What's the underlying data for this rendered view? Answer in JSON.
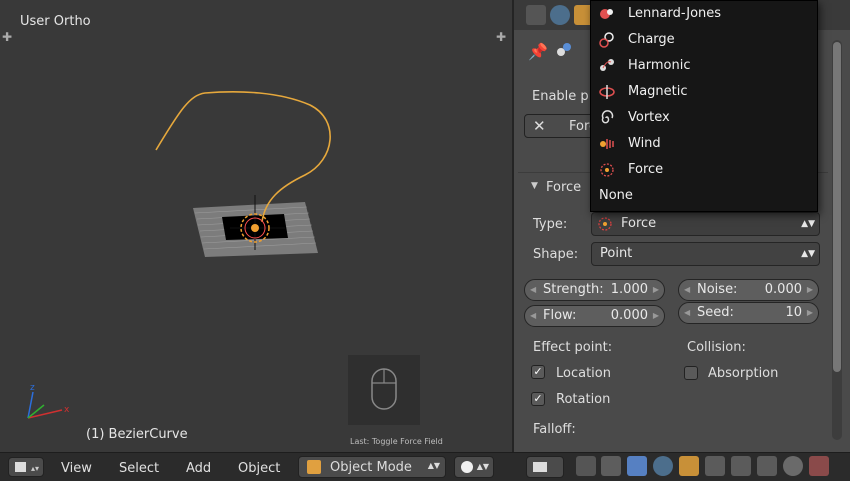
{
  "viewport": {
    "title": "User Ortho",
    "object_label": "(1) BezierCurve",
    "last_operator": "Last: Toggle Force Field"
  },
  "bottom_bar": {
    "menu": [
      "View",
      "Select",
      "Add",
      "Object"
    ],
    "mode": "Object Mode"
  },
  "panel": {
    "enable_label": "Enable p",
    "force_button": "Force",
    "section_title": "Force",
    "type_label": "Type:",
    "type_value": "Force",
    "shape_label": "Shape:",
    "shape_value": "Point",
    "strength_label": "Strength:",
    "strength_value": "1.000",
    "noise_label": "Noise:",
    "noise_value": "0.000",
    "flow_label": "Flow:",
    "flow_value": "0.000",
    "seed_label": "Seed:",
    "seed_value": "10",
    "effect_point_label": "Effect point:",
    "collision_label": "Collision:",
    "location_label": "Location",
    "location_checked": true,
    "rotation_label": "Rotation",
    "rotation_checked": true,
    "absorption_label": "Absorption",
    "absorption_checked": false,
    "falloff_label": "Falloff:"
  },
  "dropdown": {
    "items": [
      "Lennard-Jones",
      "Charge",
      "Harmonic",
      "Magnetic",
      "Vortex",
      "Wind",
      "Force",
      "None"
    ]
  },
  "colors": {
    "accent": "#f0a030",
    "curve": "#e6a83c",
    "selected_tab": "#5680c2"
  }
}
